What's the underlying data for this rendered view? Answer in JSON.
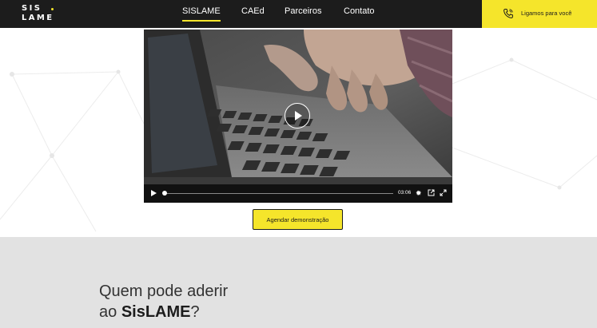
{
  "logo": {
    "line1": "SIS",
    "line2": "LAME"
  },
  "nav": {
    "items": [
      {
        "label": "SISLAME",
        "active": true
      },
      {
        "label": "CAEd",
        "active": false
      },
      {
        "label": "Parceiros",
        "active": false
      },
      {
        "label": "Contato",
        "active": false
      }
    ]
  },
  "callus": {
    "label": "Ligamos para você",
    "icon": "phone-icon"
  },
  "video": {
    "time": "03:06",
    "controls": {
      "play": "play-icon",
      "settings": "gear-icon",
      "popout": "external-link-icon",
      "fullscreen": "fullscreen-icon"
    }
  },
  "cta": {
    "label": "Agendar demonstração"
  },
  "section": {
    "headline_line1": "Quem pode aderir",
    "headline_prefix": "ao ",
    "headline_bold": "SisLAME",
    "headline_suffix": "?"
  },
  "colors": {
    "accent": "#f5e52b",
    "topbar": "#1c1c1c",
    "gray_section": "#e2e2e2"
  }
}
